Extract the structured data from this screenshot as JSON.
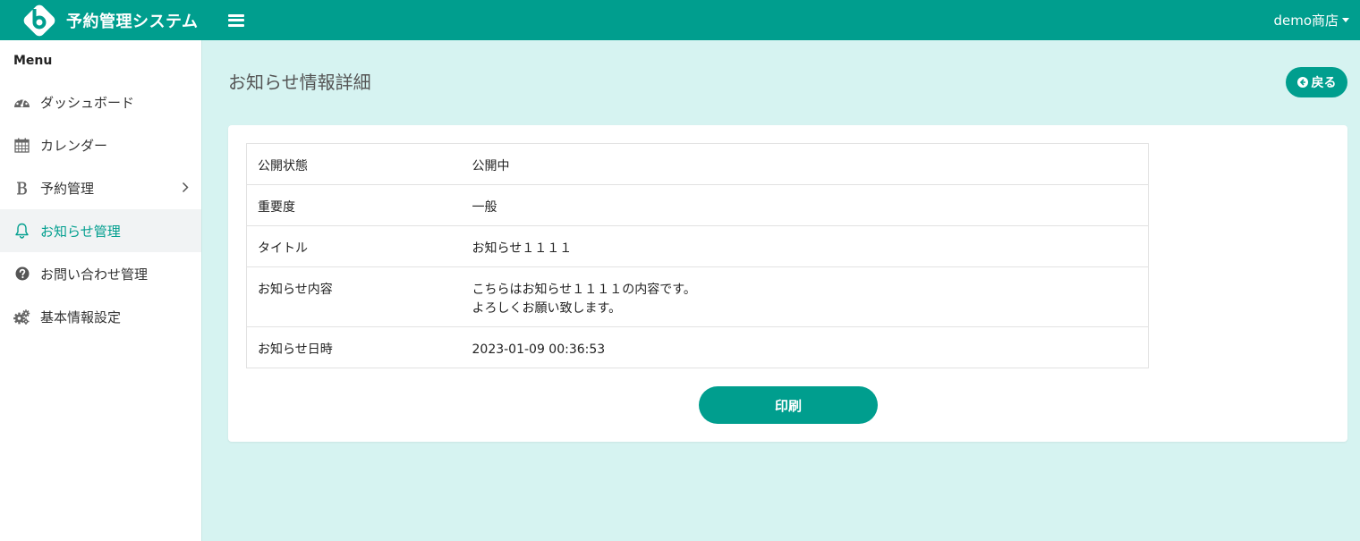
{
  "header": {
    "app_name": "予約管理システム",
    "user_menu_label": "demo商店",
    "brand_color": "#009e8e"
  },
  "sidebar": {
    "menu_title": "Menu",
    "items": [
      {
        "label": "ダッシュボード",
        "icon": "dashboard-icon"
      },
      {
        "label": "カレンダー",
        "icon": "calendar-icon"
      },
      {
        "label": "予約管理",
        "icon": "bold-b-icon",
        "has_submenu": true
      },
      {
        "label": "お知らせ管理",
        "icon": "bell-icon",
        "active": true
      },
      {
        "label": "お問い合わせ管理",
        "icon": "question-circle-icon"
      },
      {
        "label": "基本情報設定",
        "icon": "gears-icon"
      }
    ]
  },
  "main": {
    "page_title": "お知らせ情報詳細",
    "back_button_label": "戻る",
    "detail": {
      "rows": [
        {
          "label": "公開状態",
          "value": "公開中"
        },
        {
          "label": "重要度",
          "value": "一般"
        },
        {
          "label": "タイトル",
          "value": "お知らせ１１１１"
        },
        {
          "label": "お知らせ内容",
          "value_lines": [
            "こちらはお知らせ１１１１の内容です。",
            "よろしくお願い致します。"
          ]
        },
        {
          "label": "お知らせ日時",
          "value": "2023-01-09 00:36:53"
        }
      ]
    },
    "print_button_label": "印刷"
  },
  "colors": {
    "accent": "#009e8e",
    "background": "#d6f3f1",
    "status_published": "#c9302c"
  }
}
